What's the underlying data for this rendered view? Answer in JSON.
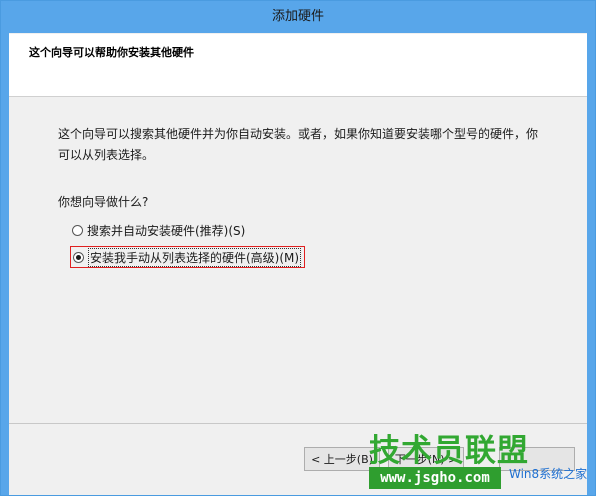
{
  "window": {
    "title": "添加硬件"
  },
  "header": {
    "title": "这个向导可以帮助你安装其他硬件"
  },
  "content": {
    "description_line1": "这个向导可以搜索其他硬件并为你自动安装。或者，如果你知道要安装哪个型号的硬件，你",
    "description_line2": "可以从列表选择。",
    "question": "你想向导做什么?",
    "options": [
      {
        "label": "搜索并自动安装硬件(推荐)(S)",
        "checked": false
      },
      {
        "label": "安装我手动从列表选择的硬件(高级)(M)",
        "checked": true
      }
    ]
  },
  "buttons": {
    "back": "< 上一步(B)",
    "next": "下一步(N) >",
    "cancel": ""
  },
  "watermark": {
    "brand": "技术员联盟",
    "site": "www.jsgho.com",
    "extra": "Win8系统之家"
  },
  "colors": {
    "title_bar": "#58a6ea",
    "highlight_border": "#e02020",
    "watermark_green": "#32a832"
  }
}
